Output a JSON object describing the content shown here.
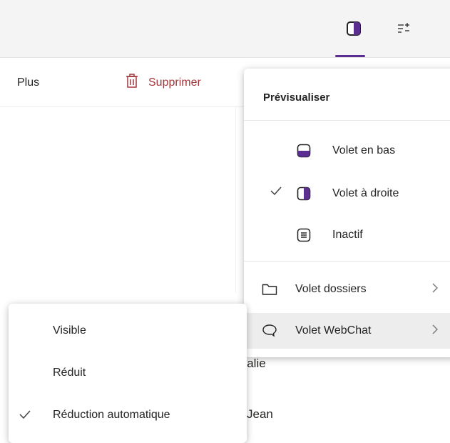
{
  "header": {
    "icons": [
      "preview-pane-icon",
      "filter-icon"
    ],
    "accent_color": "#5c2e91"
  },
  "toolbar": {
    "more_label": "Plus",
    "delete_label": "Supprimer",
    "delete_color": "#a4373a"
  },
  "message_list": {
    "items": [
      "Isalie",
      "Jean"
    ]
  },
  "preview_menu": {
    "header": "Prévisualiser",
    "options": [
      {
        "label": "Volet en bas",
        "icon": "bottom-pane-icon",
        "checked": false
      },
      {
        "label": "Volet à droite",
        "icon": "right-pane-icon",
        "checked": true
      },
      {
        "label": "Inactif",
        "icon": "inactive-pane-icon",
        "checked": false
      }
    ],
    "submenus": [
      {
        "label": "Volet dossiers",
        "icon": "folder-icon",
        "highlighted": false
      },
      {
        "label": "Volet WebChat",
        "icon": "chat-icon",
        "highlighted": true
      }
    ]
  },
  "visibility_menu": {
    "options": [
      {
        "label": "Visible",
        "checked": false
      },
      {
        "label": "Réduit",
        "checked": false
      },
      {
        "label": "Réduction automatique",
        "checked": true
      }
    ]
  }
}
